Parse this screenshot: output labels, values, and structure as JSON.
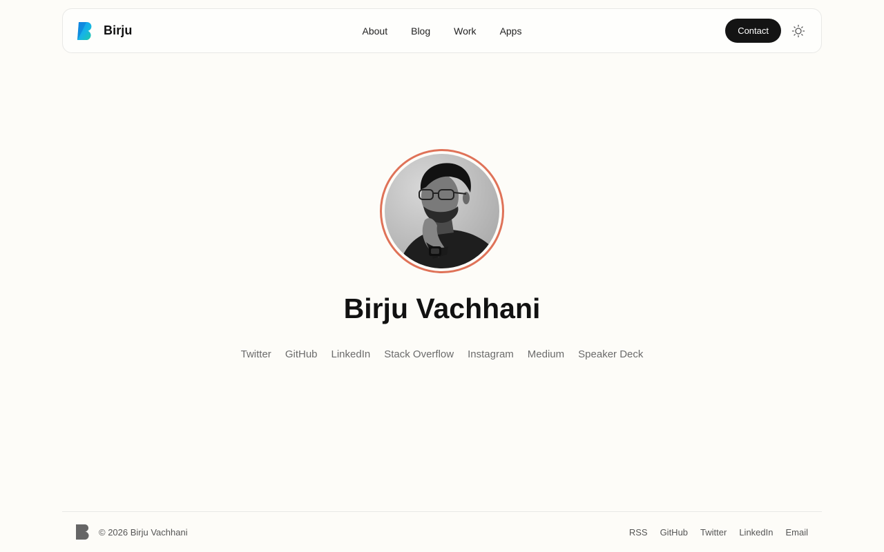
{
  "header": {
    "brand_name": "Birju",
    "nav": [
      {
        "label": "About"
      },
      {
        "label": "Blog"
      },
      {
        "label": "Work"
      },
      {
        "label": "Apps"
      }
    ],
    "contact_label": "Contact"
  },
  "hero": {
    "name": "Birju Vachhani",
    "social_links": [
      {
        "label": "Twitter"
      },
      {
        "label": "GitHub"
      },
      {
        "label": "LinkedIn"
      },
      {
        "label": "Stack Overflow"
      },
      {
        "label": "Instagram"
      },
      {
        "label": "Medium"
      },
      {
        "label": "Speaker Deck"
      }
    ]
  },
  "footer": {
    "copyright": "© 2026 Birju Vachhani",
    "links": [
      {
        "label": "RSS"
      },
      {
        "label": "GitHub"
      },
      {
        "label": "Twitter"
      },
      {
        "label": "LinkedIn"
      },
      {
        "label": "Email"
      }
    ]
  },
  "icons": {
    "brand": "b-logo-icon",
    "theme": "sun-icon"
  },
  "colors": {
    "background": "#fdfcf8",
    "avatar_ring": "#df7258",
    "contact_button": "#141414",
    "link_muted": "#6b6b6b"
  }
}
